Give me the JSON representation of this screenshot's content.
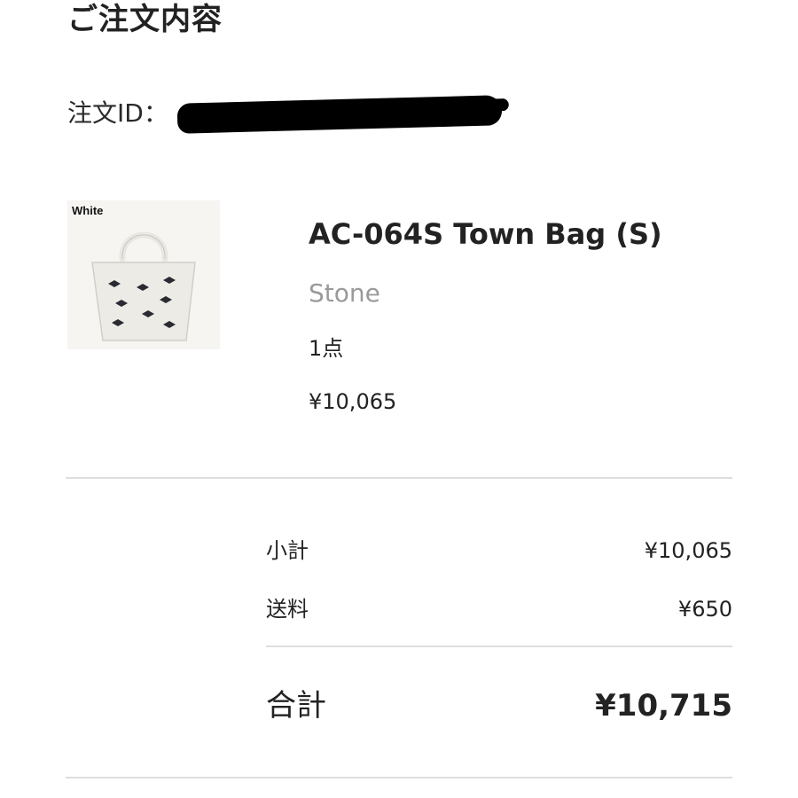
{
  "header": {
    "title": "ご注文内容"
  },
  "order": {
    "id_label": "注文ID："
  },
  "product": {
    "thumbnail_label": "White",
    "name": "AC-064S Town Bag (S)",
    "color": "Stone",
    "quantity": "1点",
    "price": "¥10,065"
  },
  "summary": {
    "subtotal_label": "小計",
    "subtotal_value": "¥10,065",
    "shipping_label": "送料",
    "shipping_value": "¥650",
    "total_label": "合計",
    "total_value": "¥10,715"
  }
}
